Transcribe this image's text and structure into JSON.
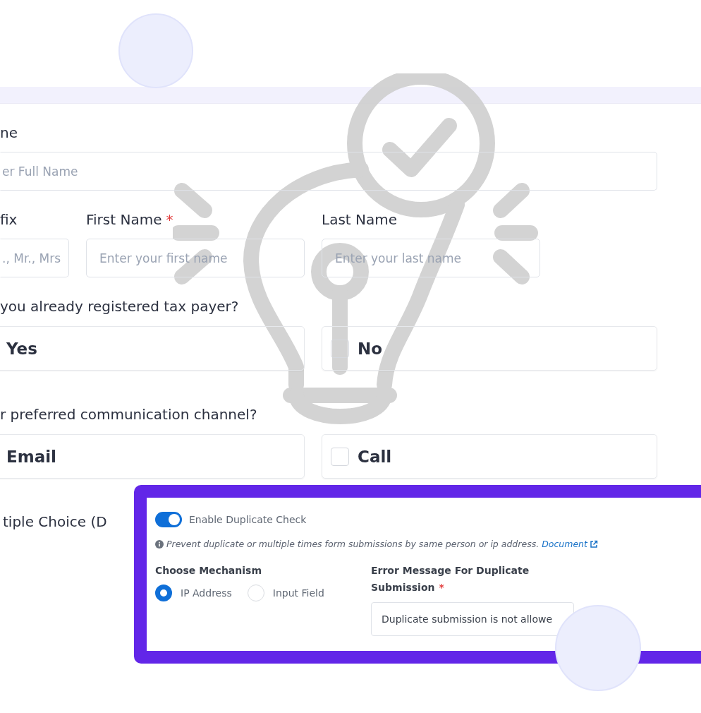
{
  "form": {
    "full_name": {
      "label": "ne",
      "placeholder": "er Full Name"
    },
    "name_fields": [
      {
        "label": "fix",
        "placeholder": "., Mr., Mrs",
        "cut": true
      },
      {
        "label": "First Name",
        "required_mark": "*",
        "placeholder": "Enter your first name",
        "cut": false
      },
      {
        "label": "Last Name",
        "placeholder": "Enter your last name",
        "cut": false
      }
    ],
    "questions": [
      {
        "label": "you already registered tax payer?",
        "options": [
          {
            "label": "Yes",
            "kind": "plain"
          },
          {
            "label": "No",
            "kind": "checkbox",
            "checked": false
          }
        ]
      },
      {
        "label": "r preferred communication channel?",
        "options": [
          {
            "label": "Email",
            "kind": "plain"
          },
          {
            "label": "Call",
            "kind": "checkbox",
            "checked": false
          }
        ]
      }
    ],
    "cut_label": "tiple Choice (D"
  },
  "duplicate_panel": {
    "toggle": {
      "label": "Enable Duplicate Check",
      "on": true
    },
    "help_text": "Prevent duplicate or multiple times form submissions by same person or ip address.",
    "help_link": "Document",
    "mechanism": {
      "label": "Choose Mechanism",
      "options": [
        {
          "label": "IP Address",
          "selected": true
        },
        {
          "label": "Input Field",
          "selected": false
        }
      ]
    },
    "error_message": {
      "label": "Error Message For Duplicate Submission",
      "required_mark": "*",
      "value": "Duplicate submission is not allowe"
    }
  }
}
